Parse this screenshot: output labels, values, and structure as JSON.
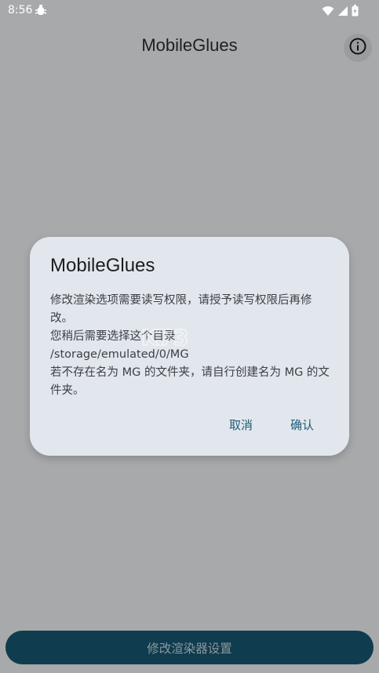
{
  "status_bar": {
    "time": "8:56",
    "notification_icon": "bug-notification-icon",
    "wifi_icon": "wifi-icon",
    "signal_icon": "signal-icon",
    "battery_icon": "battery-icon"
  },
  "app_bar": {
    "title": "MobileGlues",
    "info_icon": "info-icon"
  },
  "dialog": {
    "title": "MobileGlues",
    "message_lines": [
      "修改渲染选项需要读写权限，请授予读写权限后再修改。",
      "您稍后需要选择这个目录",
      "/storage/emulated/0/MG",
      "若不存在名为 MG 的文件夹，请自行创建名为 MG 的文件夹。"
    ],
    "cancel_label": "取消",
    "confirm_label": "确认"
  },
  "bottom_button": {
    "label": "修改渲染器设置"
  },
  "colors": {
    "scrim_background": "#a7a9ab",
    "dialog_background": "#e2e7ee",
    "accent": "#1f5b76",
    "bottom_button_background": "#0f3c4e"
  }
}
